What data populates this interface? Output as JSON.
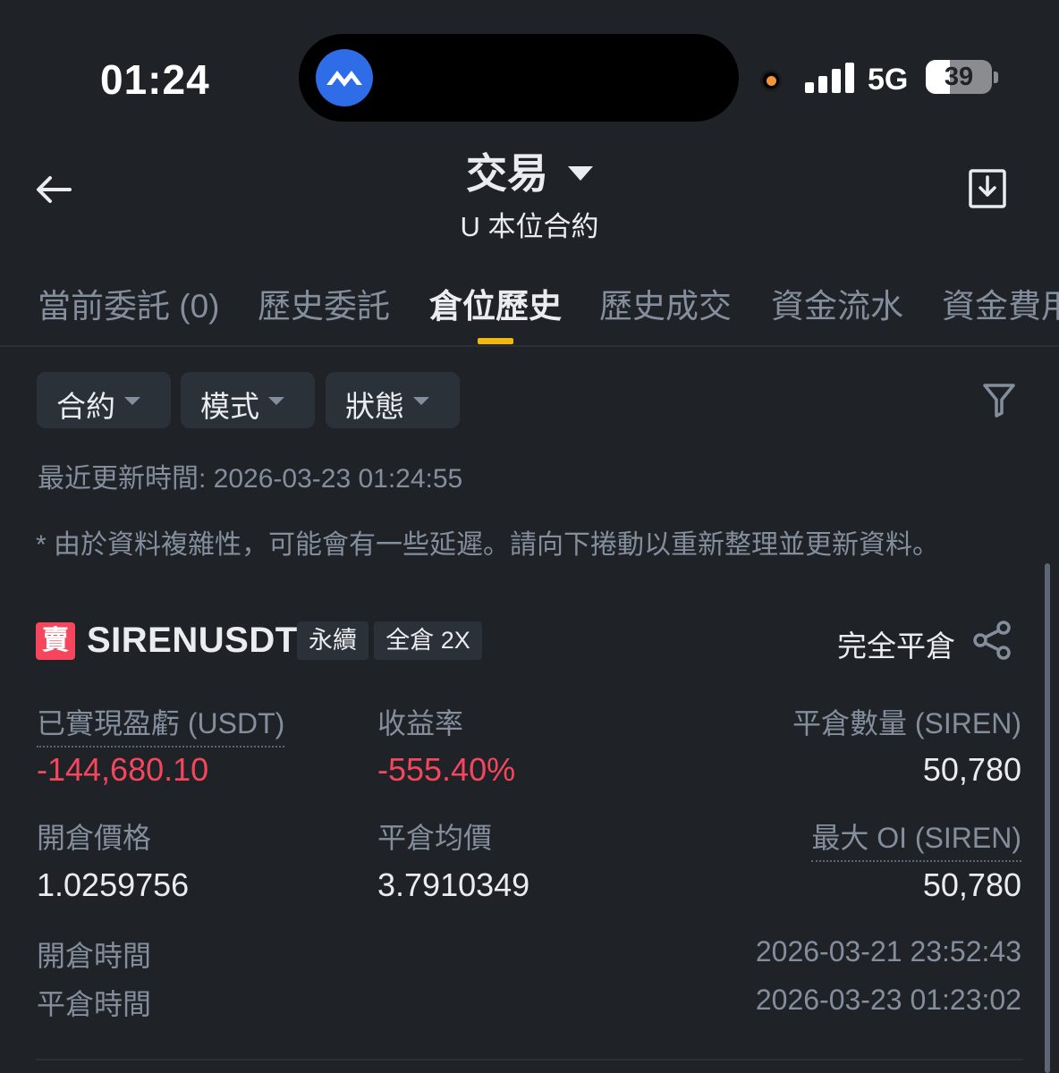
{
  "status_bar": {
    "time": "01:24",
    "network": "5G",
    "battery": "39",
    "battery_level": 0.39,
    "app_icon": "app-badge-icon"
  },
  "header": {
    "title": "交易",
    "subtitle": "U 本位合約"
  },
  "tabs": [
    {
      "label": "當前委託 (0)",
      "active": false
    },
    {
      "label": "歷史委託",
      "active": false
    },
    {
      "label": "倉位歷史",
      "active": true
    },
    {
      "label": "歷史成交",
      "active": false
    },
    {
      "label": "資金流水",
      "active": false
    },
    {
      "label": "資金費用",
      "active": false
    }
  ],
  "filters": {
    "contract": "合約",
    "mode": "模式",
    "status": "狀態"
  },
  "updated": "最近更新時間: 2026-03-23 01:24:55",
  "note": "* 由於資料複雜性，可能會有一些延遲。請向下捲動以重新整理並更新資料。",
  "position": {
    "side": "賣",
    "symbol": "SIRENUSDT",
    "type_tag": "永續",
    "margin_tag": "全倉 2X",
    "close_status": "完全平倉",
    "fields": {
      "realized_pnl_label": "已實現盈虧 (USDT)",
      "realized_pnl": "-144,680.10",
      "roi_label": "收益率",
      "roi": "-555.40%",
      "close_qty_label": "平倉數量 (SIREN)",
      "close_qty": "50,780",
      "entry_price_label": "開倉價格",
      "entry_price": "1.0259756",
      "avg_close_label": "平倉均價",
      "avg_close": "3.7910349",
      "max_oi_label": "最大 OI (SIREN)",
      "max_oi": "50,780",
      "open_time_label": "開倉時間",
      "open_time": "2026-03-21 23:52:43",
      "close_time_label": "平倉時間",
      "close_time": "2026-03-23 01:23:02"
    }
  },
  "colors": {
    "background": "#1f2227",
    "accent": "#f0b90b",
    "negative": "#f6465d",
    "muted": "#848e9c",
    "chip": "#2b3139"
  }
}
